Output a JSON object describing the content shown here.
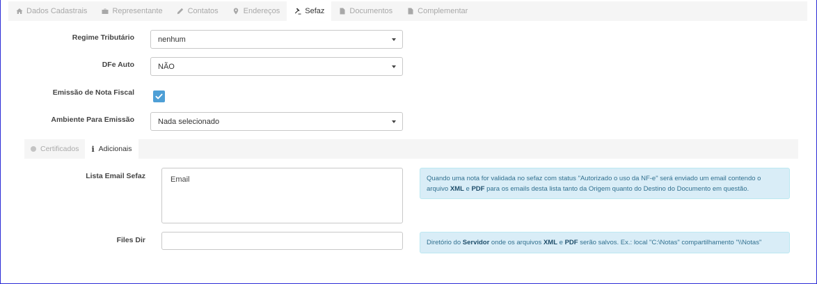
{
  "tabs": [
    {
      "label": "Dados Cadastrais",
      "icon": "home-icon"
    },
    {
      "label": "Representante",
      "icon": "briefcase-icon"
    },
    {
      "label": "Contatos",
      "icon": "pencil-icon"
    },
    {
      "label": "Endereços",
      "icon": "map-marker-icon"
    },
    {
      "label": "Sefaz",
      "icon": "gavel-icon"
    },
    {
      "label": "Documentos",
      "icon": "file-icon"
    },
    {
      "label": "Complementar",
      "icon": "file-icon"
    }
  ],
  "active_tab": "Sefaz",
  "form": {
    "regime_label": "Regime Tributário",
    "regime_value": "nenhum",
    "dfe_label": "DFe Auto",
    "dfe_value": "NÃO",
    "emissao_label": "Emissão de Nota Fiscal",
    "emissao_checked": true,
    "ambiente_label": "Ambiente Para Emissão",
    "ambiente_value": "Nada selecionado"
  },
  "subtabs": [
    {
      "label": "Certificados"
    },
    {
      "label": "Adicionais"
    }
  ],
  "adicionais": {
    "email_label": "Lista Email Sefaz",
    "email_value": "Email",
    "email_help_1": "Quando uma nota for validada no sefaz com status \"Autorizado o uso da NF-e\" será enviado um email contendo o arquivo ",
    "email_help_xml": "XML",
    "email_help_2": " e ",
    "email_help_pdf": "PDF",
    "email_help_3": " para os emails desta lista tanto da Origem quanto do Destino do Documento em questão.",
    "files_label": "Files Dir",
    "files_value": "",
    "files_help_1": "Diretório do ",
    "files_help_server": "Servidor",
    "files_help_2": " onde os arquivos ",
    "files_help_xml": "XML",
    "files_help_3": " e ",
    "files_help_pdf": "PDF",
    "files_help_4": " serão salvos. Ex.: local \"C:\\Notas\" compartilhamento \"\\\\Notas\""
  },
  "colors": {
    "checkbox": "#4e9fd6",
    "alert_bg": "#d9edf7",
    "alert_text": "#31708f",
    "frame_border": "#2b2bd6"
  }
}
